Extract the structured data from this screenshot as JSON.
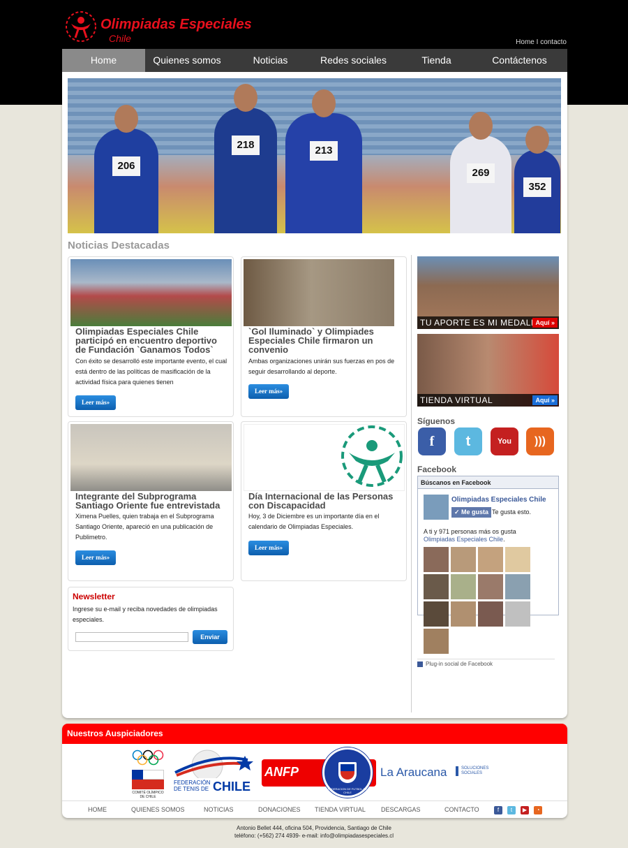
{
  "brand": {
    "name": "Olimpiadas Especiales",
    "sub": "Chile",
    "red": "#e8101d"
  },
  "toplinks": {
    "home": "Home",
    "sep": " I ",
    "contact": "contacto"
  },
  "nav": [
    "Home",
    "Quienes somos",
    "Noticias",
    "Redes sociales",
    "Tienda",
    "Contáctenos"
  ],
  "hero": {
    "bibs": [
      "206",
      "218",
      "213",
      "269",
      "352"
    ]
  },
  "news": {
    "title": "Noticias Destacadas",
    "read_more": "Leer más»",
    "items": [
      {
        "title": "Olimpiadas Especiales Chile participó en encuentro deportivo de Fundación `Ganamos Todos`",
        "text": "Con éxito se desarrolló este importante evento, el cual está dentro de las políticas de masificación de la actividad física para quienes tienen"
      },
      {
        "title": "`Gol Iluminado` y Olimpiades Especiales Chile firmaron un convenio",
        "text": "Ambas organizaciones unirán sus fuerzas en pos de seguir desarrollando al deporte."
      },
      {
        "title": "Integrante del Subprograma Santiago Oriente fue entrevistada",
        "text": "Ximena Puelles, quien trabaja en el Subprograma Santiago Oriente, apareció en una publicación de Publimetro."
      },
      {
        "title": "Día Internacional de las Personas con Discapacidad",
        "text": "Hoy, 3 de Diciembre es un importante día en el calendario de Olimpiadas Especiales."
      }
    ]
  },
  "newsletter": {
    "title": "Newsletter",
    "text": "Ingrese su e-mail y reciba novedades de olimpiadas especiales.",
    "placeholder": "",
    "button": "Enviar"
  },
  "sidebar": {
    "promo1": {
      "label": "TU APORTE ES MI MEDALLA",
      "action": "Aquí »"
    },
    "promo2": {
      "label": "TIENDA VIRTUAL",
      "action": "Aquí »"
    },
    "follow_title": "Síguenos",
    "social": [
      "facebook-icon",
      "twitter-icon",
      "youtube-icon",
      "rss-icon"
    ],
    "facebook_title": "Facebook"
  },
  "facebook": {
    "header": "Búscanos en Facebook",
    "page": "Olimpiadas Especiales Chile",
    "like": "Me gusta",
    "likes_text": "Te gusta esto.",
    "count_prefix": "A ti y 971 personas más os gusta ",
    "count_link": "Olimpiadas Especiales Chile",
    "count_suffix": ".",
    "plugin": "Plug-in social de Facebook"
  },
  "sponsors": {
    "title": "Nuestros Auspiciadores",
    "coch": "COMITÉ OLÍMPICO DE CHILE",
    "tenis": "FEDERACIÓN DE TENIS DE",
    "tenis_big": "CHILE",
    "anfp": "ANFP",
    "futbol": "FEDERACION DE FUTBOL DE CHILE",
    "araucana": "La Araucana",
    "araucana_sub": "SOLUCIONES SOCIALES"
  },
  "footer": {
    "links": [
      "HOME",
      "QUIENES SOMOS",
      "NOTICIAS",
      "DONACIONES",
      "TIENDA VIRTUAL",
      "DESCARGAS",
      "CONTACTO"
    ],
    "address1": "Antonio Bellet 444, oficina 504, Providencia, Santiago de Chile",
    "address2": "teléfono: (+562) 274 4939- e-mail: info@olimpiadasespeciales.cl"
  }
}
